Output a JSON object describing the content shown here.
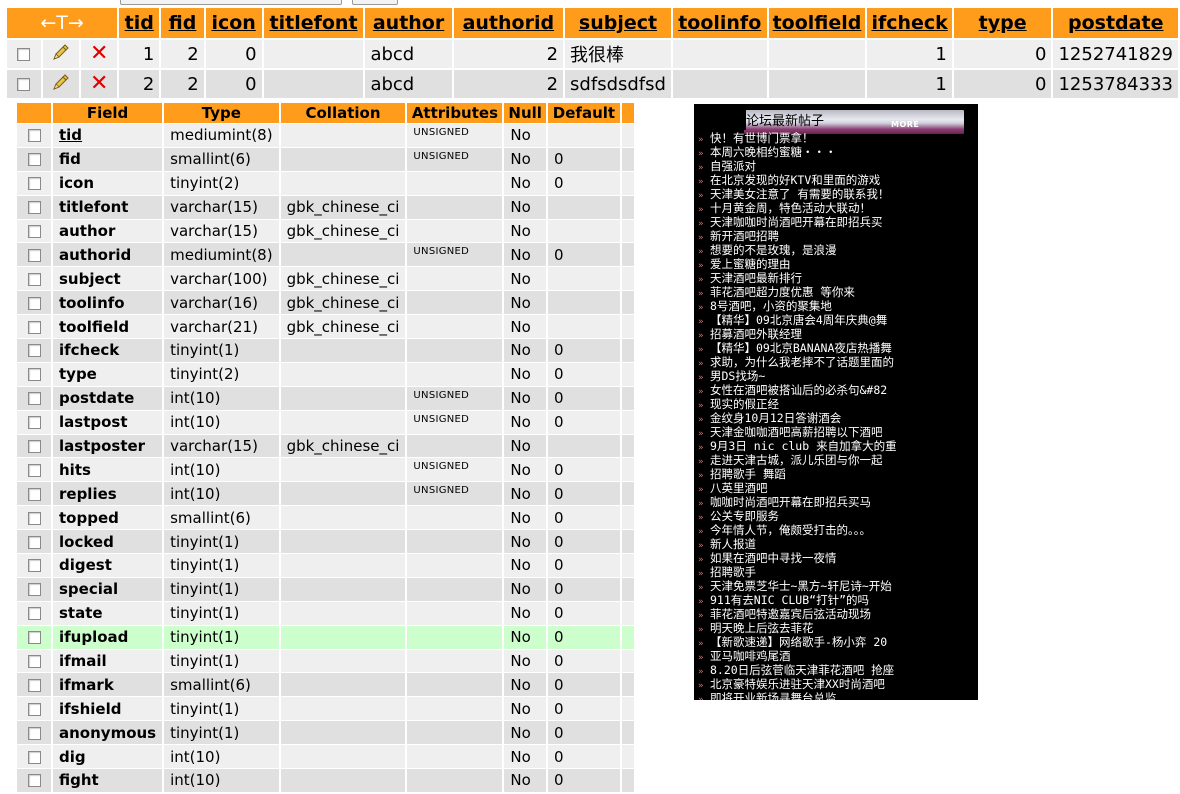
{
  "browse": {
    "nav_arrows": "←T→",
    "columns": [
      "tid",
      "fid",
      "icon",
      "titlefont",
      "author",
      "authorid",
      "subject",
      "toolinfo",
      "toolfield",
      "ifcheck",
      "type",
      "postdate"
    ],
    "rows": [
      [
        "1",
        "2",
        "0",
        "",
        "abcd",
        "2",
        "我很棒",
        "",
        "",
        "1",
        "0",
        "1252741829"
      ],
      [
        "2",
        "2",
        "0",
        "",
        "abcd",
        "2",
        "sdfsdsdfsd",
        "",
        "",
        "1",
        "0",
        "1253784333"
      ]
    ],
    "colors": {
      "header": "#ff9c1c",
      "row_odd": "#efefef",
      "row_even": "#e0e0e0",
      "delete": "#e00000"
    }
  },
  "structure": {
    "columns": [
      "Field",
      "Type",
      "Collation",
      "Attributes",
      "Null",
      "Default"
    ],
    "rows": [
      [
        "tid",
        "mediumint(8)",
        "",
        "UNSIGNED",
        "No",
        ""
      ],
      [
        "fid",
        "smallint(6)",
        "",
        "UNSIGNED",
        "No",
        "0"
      ],
      [
        "icon",
        "tinyint(2)",
        "",
        "",
        "No",
        "0"
      ],
      [
        "titlefont",
        "varchar(15)",
        "gbk_chinese_ci",
        "",
        "No",
        ""
      ],
      [
        "author",
        "varchar(15)",
        "gbk_chinese_ci",
        "",
        "No",
        ""
      ],
      [
        "authorid",
        "mediumint(8)",
        "",
        "UNSIGNED",
        "No",
        "0"
      ],
      [
        "subject",
        "varchar(100)",
        "gbk_chinese_ci",
        "",
        "No",
        ""
      ],
      [
        "toolinfo",
        "varchar(16)",
        "gbk_chinese_ci",
        "",
        "No",
        ""
      ],
      [
        "toolfield",
        "varchar(21)",
        "gbk_chinese_ci",
        "",
        "No",
        ""
      ],
      [
        "ifcheck",
        "tinyint(1)",
        "",
        "",
        "No",
        "0"
      ],
      [
        "type",
        "tinyint(2)",
        "",
        "",
        "No",
        "0"
      ],
      [
        "postdate",
        "int(10)",
        "",
        "UNSIGNED",
        "No",
        "0"
      ],
      [
        "lastpost",
        "int(10)",
        "",
        "UNSIGNED",
        "No",
        "0"
      ],
      [
        "lastposter",
        "varchar(15)",
        "gbk_chinese_ci",
        "",
        "No",
        ""
      ],
      [
        "hits",
        "int(10)",
        "",
        "UNSIGNED",
        "No",
        "0"
      ],
      [
        "replies",
        "int(10)",
        "",
        "UNSIGNED",
        "No",
        "0"
      ],
      [
        "topped",
        "smallint(6)",
        "",
        "",
        "No",
        "0"
      ],
      [
        "locked",
        "tinyint(1)",
        "",
        "",
        "No",
        "0"
      ],
      [
        "digest",
        "tinyint(1)",
        "",
        "",
        "No",
        "0"
      ],
      [
        "special",
        "tinyint(1)",
        "",
        "",
        "No",
        "0"
      ],
      [
        "state",
        "tinyint(1)",
        "",
        "",
        "No",
        "0"
      ],
      [
        "ifupload",
        "tinyint(1)",
        "",
        "",
        "No",
        "0"
      ],
      [
        "ifmail",
        "tinyint(1)",
        "",
        "",
        "No",
        "0"
      ],
      [
        "ifmark",
        "smallint(6)",
        "",
        "",
        "No",
        "0"
      ],
      [
        "ifshield",
        "tinyint(1)",
        "",
        "",
        "No",
        "0"
      ],
      [
        "anonymous",
        "tinyint(1)",
        "",
        "",
        "No",
        "0"
      ],
      [
        "dig",
        "int(10)",
        "",
        "",
        "No",
        "0"
      ],
      [
        "fight",
        "int(10)",
        "",
        "",
        "No",
        "0"
      ]
    ],
    "highlighted_field": "ifupload",
    "colors": {
      "highlight": "#ccffcc"
    }
  },
  "forum_box": {
    "title": "论坛最新帖子",
    "more_label": "MORE",
    "items": [
      "快！有世博门票拿！",
      "本周六晚相约蜜糖・・・",
      "自强派对",
      "在北京发现的好KTV和里面的游戏",
      "天津美女注意了 有需要的联系我！",
      "十月黄金周，特色活动大联动！",
      "天津咖咖时尚酒吧开幕在即招兵买",
      "新开酒吧招聘",
      "想要的不是玫瑰，是浪漫",
      "爱上蜜糖的理由",
      "天津酒吧最新排行",
      "菲花酒吧超力度优惠 等你来",
      "8号酒吧，小资的聚集地",
      "【精华】09北京唐会4周年庆典@舞",
      "招募酒吧外联经理",
      "【精华】09北京BANANA夜店热播舞",
      "求助，为什么我老摔不了话题里面的",
      "男DS找场~",
      "女性在酒吧被搭讪后的必杀句&#82",
      "现实的假正经",
      "金纹身10月12日答谢酒会",
      "天津金咖咖酒吧高薪招聘以下酒吧",
      "9月3日 nic club 来自加拿大的重",
      "走进天津古城，派儿乐团与你一起",
      "招聘歌手 舞蹈",
      "八英里酒吧",
      "咖咖时尚酒吧开幕在即招兵买马",
      "公关专即服务",
      "今年情人节，俺颇受打击的。。。",
      "新人报道",
      "如果在酒吧中寻找一夜情",
      "招聘歌手",
      "天津免票芝华士~黑方~轩尼诗~开始",
      "911有去NIC CLUB“打针”的吗",
      "菲花酒吧特邀嘉宾后弦活动现场",
      "明天晚上后弦去菲花",
      "【新歌速递】网络歌手-杨小弈 20",
      "亚马咖啡鸡尾酒",
      "8.20日后弦菅临天津菲花酒吧 抢座",
      "北京豪特娱乐进驻天津XX时尚酒吧",
      "即将开业新场寻舞台总监"
    ]
  }
}
